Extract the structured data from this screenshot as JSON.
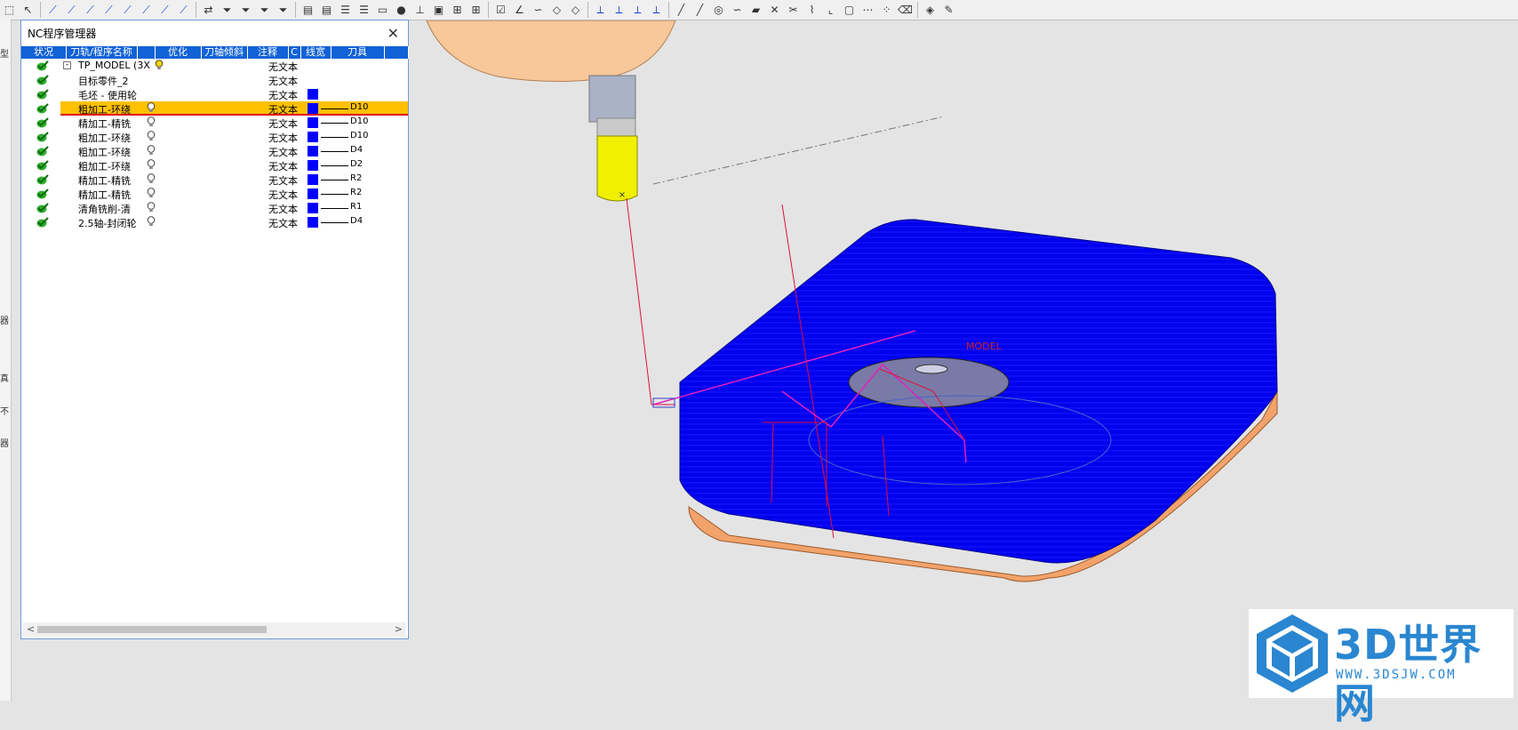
{
  "toolbar": {
    "icons": [
      "select-icon",
      "pointer-icon",
      "toolpath-icon",
      "toolpath-icon",
      "toolpath-icon",
      "toolpath-icon",
      "toolpath-icon",
      "toolpath-icon",
      "toolpath-icon",
      "toolpath-icon",
      "swap-icon",
      "filter-icon",
      "filter-icon",
      "filter-icon",
      "filter-icon",
      "book-icon",
      "book-icon",
      "list-icon",
      "list-icon",
      "comment-icon",
      "sphere-icon",
      "tool-icon",
      "box-icon",
      "tree-icon",
      "tree-icon",
      "check-icon",
      "angle-icon",
      "curve-icon",
      "surface-icon",
      "surface-icon",
      "axis-icon",
      "axis-icon",
      "axis-icon",
      "axis-icon",
      "line-icon",
      "line-icon",
      "circle-icon",
      "curve-icon",
      "plane-icon",
      "cross-icon",
      "cut-icon",
      "trim-icon",
      "corner-icon",
      "frame-icon",
      "xyz-icon",
      "nodes-icon",
      "eraser-icon",
      "view-icon",
      "pen-icon"
    ]
  },
  "left_strip": {
    "chars": [
      "型",
      "器",
      "真",
      "不",
      "器"
    ]
  },
  "nc_manager": {
    "title": "NC程序管理器",
    "columns": [
      "状况",
      "刀轨/程序名称",
      "优化",
      "刀轴倾斜",
      "注释",
      "C",
      "线宽",
      "刀具"
    ],
    "rows": [
      {
        "name": "TP_MODEL (3X",
        "note": "无文本",
        "tool": "",
        "bulb": true,
        "swatch": false,
        "tree": "⊟",
        "selected": false
      },
      {
        "name": "目标零件_2",
        "note": "无文本",
        "tool": "",
        "bulb": false,
        "swatch": false,
        "tree": "",
        "selected": false
      },
      {
        "name": "毛坯 - 使用轮",
        "note": "无文本",
        "tool": "",
        "bulb": false,
        "swatch": true,
        "tree": "",
        "selected": false
      },
      {
        "name": "粗加工-环绕",
        "note": "无文本",
        "tool": "D10",
        "bulb": true,
        "swatch": true,
        "tree": "",
        "selected": true
      },
      {
        "name": "精加工-精铣",
        "note": "无文本",
        "tool": "D10",
        "bulb": true,
        "swatch": true,
        "tree": "",
        "selected": false
      },
      {
        "name": "粗加工-环绕",
        "note": "无文本",
        "tool": "D10",
        "bulb": true,
        "swatch": true,
        "tree": "",
        "selected": false
      },
      {
        "name": "粗加工-环绕",
        "note": "无文本",
        "tool": "D4",
        "bulb": true,
        "swatch": true,
        "tree": "",
        "selected": false
      },
      {
        "name": "粗加工-环绕",
        "note": "无文本",
        "tool": "D2",
        "bulb": true,
        "swatch": true,
        "tree": "",
        "selected": false
      },
      {
        "name": "精加工-精铣",
        "note": "无文本",
        "tool": "R2",
        "bulb": true,
        "swatch": true,
        "tree": "",
        "selected": false
      },
      {
        "name": "精加工-精铣",
        "note": "无文本",
        "tool": "R2",
        "bulb": true,
        "swatch": true,
        "tree": "",
        "selected": false
      },
      {
        "name": "清角铣削-清",
        "note": "无文本",
        "tool": "R1",
        "bulb": true,
        "swatch": true,
        "tree": "",
        "selected": false
      },
      {
        "name": "2.5轴-封闭轮",
        "note": "无文本",
        "tool": "D4",
        "bulb": true,
        "swatch": true,
        "tree": "",
        "selected": false
      }
    ],
    "scroll_left": "<",
    "scroll_right": ">"
  },
  "viewport": {
    "model_label": "MODEL"
  },
  "watermark": {
    "title": "3D世界网",
    "url": "WWW.3DSJW.COM"
  },
  "colors": {
    "header_blue": "#1162d6",
    "selection": "#ffc000",
    "toolpath": "#0000ee",
    "stock": "#f2a36b",
    "tool_yellow": "#f0f000"
  }
}
